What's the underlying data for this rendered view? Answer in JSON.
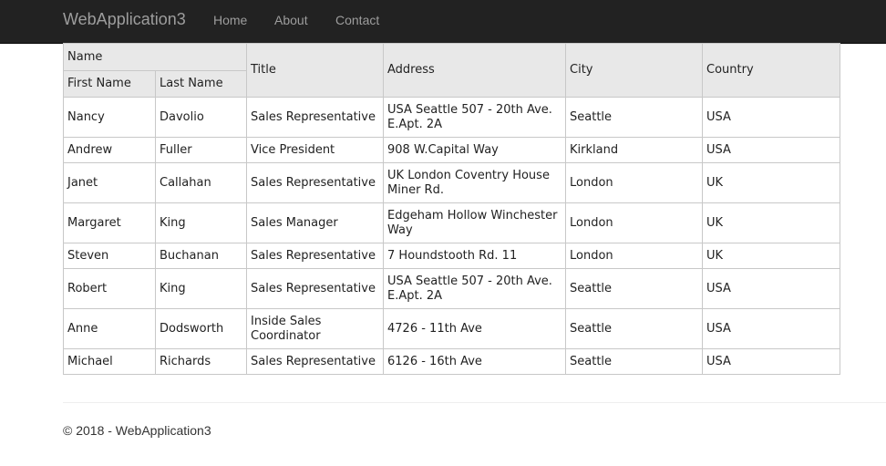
{
  "navbar": {
    "brand": "WebApplication3",
    "links": [
      "Home",
      "About",
      "Contact"
    ]
  },
  "grid": {
    "group_header": "Name",
    "headers": {
      "first_name": "First Name",
      "last_name": "Last Name",
      "title": "Title",
      "address": "Address",
      "city": "City",
      "country": "Country"
    },
    "rows": [
      [
        "Nancy",
        "Davolio",
        "Sales Representative",
        "USA Seattle 507 - 20th Ave. E.Apt. 2A",
        "Seattle",
        "USA"
      ],
      [
        "Andrew",
        "Fuller",
        "Vice President",
        "908 W.Capital Way",
        "Kirkland",
        "USA"
      ],
      [
        "Janet",
        "Callahan",
        "Sales Representative",
        "UK London Coventry House Miner Rd.",
        "London",
        "UK"
      ],
      [
        "Margaret",
        "King",
        "Sales Manager",
        "Edgeham Hollow Winchester Way",
        "London",
        "UK"
      ],
      [
        "Steven",
        "Buchanan",
        "Sales Representative",
        "7 Houndstooth Rd. 11",
        "London",
        "UK"
      ],
      [
        "Robert",
        "King",
        "Sales Representative",
        "USA Seattle 507 - 20th Ave. E.Apt. 2A",
        "Seattle",
        "USA"
      ],
      [
        "Anne",
        "Dodsworth",
        "Inside Sales Coordinator",
        "4726 - 11th Ave",
        "Seattle",
        "USA"
      ],
      [
        "Michael",
        "Richards",
        "Sales Representative",
        "6126 - 16th Ave",
        "Seattle",
        "USA"
      ]
    ]
  },
  "footer": {
    "text": "© 2018 - WebApplication3"
  }
}
